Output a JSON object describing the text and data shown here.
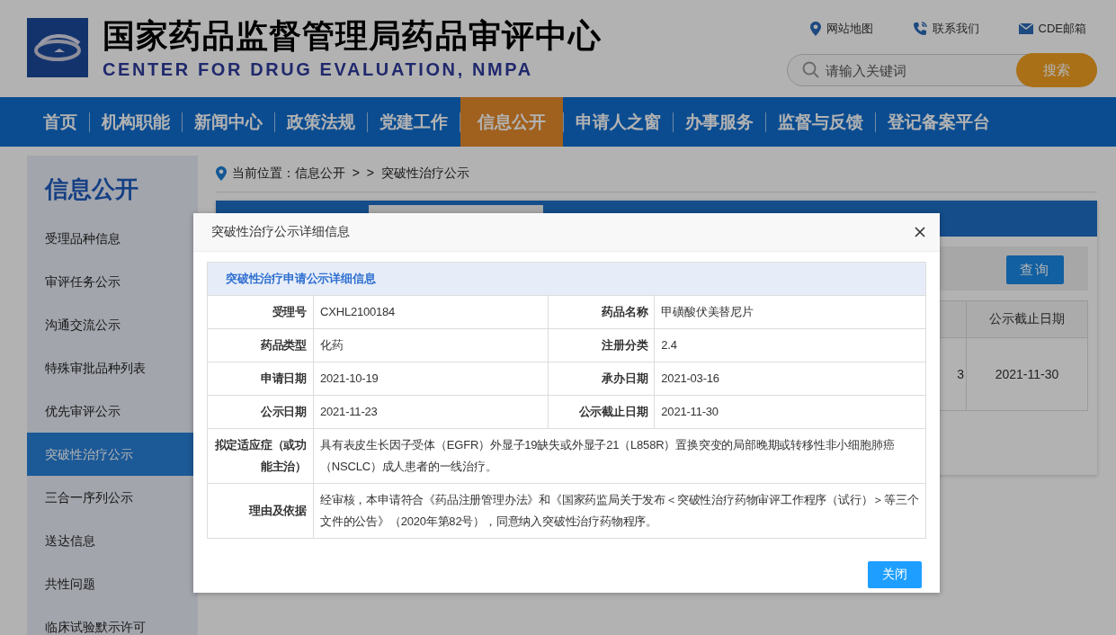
{
  "header": {
    "title": "国家药品监督管理局药品审评中心",
    "subtitle": "CENTER FOR DRUG EVALUATION, NMPA",
    "top_links": [
      {
        "label": "网站地图",
        "kind": "pin"
      },
      {
        "label": "联系我们",
        "kind": "phone"
      },
      {
        "label": "CDE邮箱",
        "kind": "mail"
      }
    ],
    "search": {
      "placeholder": "请输入关键词",
      "button": "搜索"
    }
  },
  "nav": [
    {
      "label": "首页",
      "selected": false
    },
    {
      "label": "机构职能",
      "selected": false
    },
    {
      "label": "新闻中心",
      "selected": false
    },
    {
      "label": "政策法规",
      "selected": false
    },
    {
      "label": "党建工作",
      "selected": false
    },
    {
      "label": "信息公开",
      "selected": true
    },
    {
      "label": "申请人之窗",
      "selected": false
    },
    {
      "label": "办事服务",
      "selected": false
    },
    {
      "label": "监督与反馈",
      "selected": false
    },
    {
      "label": "登记备案平台",
      "selected": false
    }
  ],
  "sidebar": {
    "title": "信息公开",
    "items": [
      {
        "label": "受理品种信息",
        "selected": false
      },
      {
        "label": "审评任务公示",
        "selected": false
      },
      {
        "label": "沟通交流公示",
        "selected": false
      },
      {
        "label": "特殊审批品种列表",
        "selected": false
      },
      {
        "label": "优先审评公示",
        "selected": false
      },
      {
        "label": "突破性治疗公示",
        "selected": true
      },
      {
        "label": "三合一序列公示",
        "selected": false
      },
      {
        "label": "送达信息",
        "selected": false
      },
      {
        "label": "共性问题",
        "selected": false
      },
      {
        "label": "临床试验默示许可",
        "selected": false
      }
    ]
  },
  "breadcrumb": "当前位置：信息公开  >  >  突破性治疗公示",
  "list_panel": {
    "query_button": "查询",
    "column_header": "公示截止日期",
    "row": {
      "column_1": "3",
      "column_2": "2021-11-30"
    }
  },
  "modal": {
    "title": "突破性治疗公示详细信息",
    "section_title": "突破性治疗申请公示详细信息",
    "rows": [
      {
        "fields": [
          {
            "label": "受理号",
            "value": "CXHL2100184"
          },
          {
            "label": "药品名称",
            "value": "甲磺酸伏美替尼片"
          }
        ]
      },
      {
        "fields": [
          {
            "label": "药品类型",
            "value": "化药"
          },
          {
            "label": "注册分类",
            "value": "2.4"
          }
        ]
      },
      {
        "fields": [
          {
            "label": "申请日期",
            "value": "2021-10-19"
          },
          {
            "label": "承办日期",
            "value": "2021-03-16"
          }
        ]
      },
      {
        "fields": [
          {
            "label": "公示日期",
            "value": "2021-11-23"
          },
          {
            "label": "公示截止日期",
            "value": "2021-11-30"
          }
        ]
      },
      {
        "fields": [
          {
            "label": "拟定适应症（或功能主治）",
            "value": "具有表皮生长因子受体（EGFR）外显子19缺失或外显子21（L858R）置换突变的局部晚期或转移性非小细胞肺癌（NSCLC）成人患者的一线治疗。"
          }
        ]
      },
      {
        "fields": [
          {
            "label": "理由及依据",
            "value": "经审核，本申请符合《药品注册管理办法》和《国家药监局关于发布＜突破性治疗药物审评工作程序（试行）＞等三个文件的公告》（2020年第82号），同意纳入突破性治疗药物程序。"
          }
        ]
      }
    ],
    "close_button": "关闭"
  }
}
